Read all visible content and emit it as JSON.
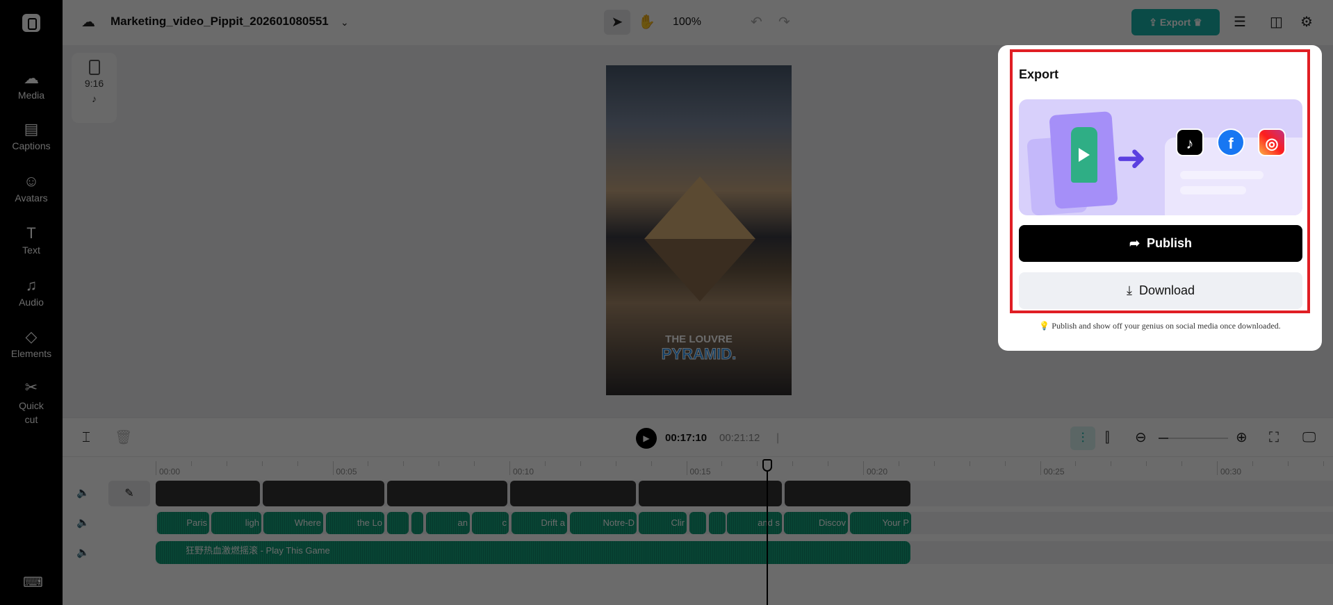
{
  "sidebar": {
    "items": [
      {
        "label": "Media",
        "icon": "cloud-upload-icon",
        "glyph": "☁"
      },
      {
        "label": "Captions",
        "icon": "captions-icon",
        "glyph": "▤"
      },
      {
        "label": "Avatars",
        "icon": "avatar-icon",
        "glyph": "☺"
      },
      {
        "label": "Text",
        "icon": "text-icon",
        "glyph": "T"
      },
      {
        "label": "Audio",
        "icon": "music-note-icon",
        "glyph": "♫"
      },
      {
        "label": "Elements",
        "icon": "elements-icon",
        "glyph": "◇"
      },
      {
        "label": "Quick cut",
        "icon": "scissors-icon",
        "glyph": "✂"
      }
    ]
  },
  "header": {
    "title": "Marketing_video_Pippit_202601080551",
    "zoom": "100%",
    "export_label": "Export"
  },
  "canvas": {
    "ratio": "9:16",
    "caption_line1": "THE LOUVRE",
    "caption_line2": "PYRAMID."
  },
  "timeline": {
    "current_time": "00:17:10",
    "total_time": "00:21:12",
    "ruler": [
      "00:00",
      "00:05",
      "00:10",
      "00:15",
      "00:20",
      "00:25",
      "00:30"
    ],
    "captions": [
      "Paris",
      "ligh",
      "Where",
      "the Lo",
      "",
      "",
      "an",
      "c",
      "Drift a",
      "Notre-D",
      "Clir",
      "",
      "",
      "and s",
      "Discov",
      "Your P"
    ],
    "audio_title": "狂野热血激燃摇滚 - Play This Game"
  },
  "export_panel": {
    "title": "Export",
    "publish_label": "Publish",
    "download_label": "Download",
    "hint": "Publish and show off your genius on social media once downloaded.",
    "socials": [
      "TikTok",
      "Facebook",
      "Instagram"
    ]
  },
  "colors": {
    "accent": "#18b3a8",
    "highlight": "#e01e24",
    "clip_green": "#12a37c"
  }
}
